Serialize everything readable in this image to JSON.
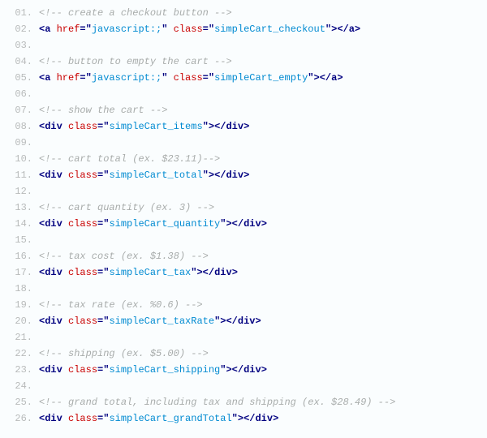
{
  "lines": [
    {
      "no": "01.",
      "type": "comment",
      "text": "<!-- create a checkout button -->"
    },
    {
      "no": "02.",
      "type": "code",
      "tokens": [
        {
          "t": "punct",
          "v": "<"
        },
        {
          "t": "tag",
          "v": "a"
        },
        {
          "t": "space",
          "v": " "
        },
        {
          "t": "attr-name",
          "v": "href"
        },
        {
          "t": "eq",
          "v": "="
        },
        {
          "t": "punct",
          "v": "\""
        },
        {
          "t": "attr-value",
          "v": "javascript:;"
        },
        {
          "t": "punct",
          "v": "\""
        },
        {
          "t": "space",
          "v": " "
        },
        {
          "t": "attr-name",
          "v": "class"
        },
        {
          "t": "eq",
          "v": "="
        },
        {
          "t": "punct",
          "v": "\""
        },
        {
          "t": "attr-value",
          "v": "simpleCart_checkout"
        },
        {
          "t": "punct",
          "v": "\""
        },
        {
          "t": "punct",
          "v": ">"
        },
        {
          "t": "punct",
          "v": "</"
        },
        {
          "t": "tag",
          "v": "a"
        },
        {
          "t": "punct",
          "v": ">"
        }
      ]
    },
    {
      "no": "03.",
      "type": "blank"
    },
    {
      "no": "04.",
      "type": "comment",
      "text": "<!-- button to empty the cart -->"
    },
    {
      "no": "05.",
      "type": "code",
      "tokens": [
        {
          "t": "punct",
          "v": "<"
        },
        {
          "t": "tag",
          "v": "a"
        },
        {
          "t": "space",
          "v": " "
        },
        {
          "t": "attr-name",
          "v": "href"
        },
        {
          "t": "eq",
          "v": "="
        },
        {
          "t": "punct",
          "v": "\""
        },
        {
          "t": "attr-value",
          "v": "javascript:;"
        },
        {
          "t": "punct",
          "v": "\""
        },
        {
          "t": "space",
          "v": " "
        },
        {
          "t": "attr-name",
          "v": "class"
        },
        {
          "t": "eq",
          "v": "="
        },
        {
          "t": "punct",
          "v": "\""
        },
        {
          "t": "attr-value",
          "v": "simpleCart_empty"
        },
        {
          "t": "punct",
          "v": "\""
        },
        {
          "t": "punct",
          "v": ">"
        },
        {
          "t": "punct",
          "v": "</"
        },
        {
          "t": "tag",
          "v": "a"
        },
        {
          "t": "punct",
          "v": ">"
        }
      ]
    },
    {
      "no": "06.",
      "type": "blank"
    },
    {
      "no": "07.",
      "type": "comment",
      "text": "<!-- show the cart -->"
    },
    {
      "no": "08.",
      "type": "code",
      "tokens": [
        {
          "t": "punct",
          "v": "<"
        },
        {
          "t": "tag",
          "v": "div"
        },
        {
          "t": "space",
          "v": " "
        },
        {
          "t": "attr-name",
          "v": "class"
        },
        {
          "t": "eq",
          "v": "="
        },
        {
          "t": "punct",
          "v": "\""
        },
        {
          "t": "attr-value",
          "v": "simpleCart_items"
        },
        {
          "t": "punct",
          "v": "\""
        },
        {
          "t": "punct",
          "v": ">"
        },
        {
          "t": "punct",
          "v": "</"
        },
        {
          "t": "tag",
          "v": "div"
        },
        {
          "t": "punct",
          "v": ">"
        }
      ]
    },
    {
      "no": "09.",
      "type": "blank"
    },
    {
      "no": "10.",
      "type": "comment",
      "text": "<!-- cart total (ex. $23.11)-->"
    },
    {
      "no": "11.",
      "type": "code",
      "tokens": [
        {
          "t": "punct",
          "v": "<"
        },
        {
          "t": "tag",
          "v": "div"
        },
        {
          "t": "space",
          "v": " "
        },
        {
          "t": "attr-name",
          "v": "class"
        },
        {
          "t": "eq",
          "v": "="
        },
        {
          "t": "punct",
          "v": "\""
        },
        {
          "t": "attr-value",
          "v": "simpleCart_total"
        },
        {
          "t": "punct",
          "v": "\""
        },
        {
          "t": "punct",
          "v": ">"
        },
        {
          "t": "punct",
          "v": "</"
        },
        {
          "t": "tag",
          "v": "div"
        },
        {
          "t": "punct",
          "v": ">"
        }
      ]
    },
    {
      "no": "12.",
      "type": "blank"
    },
    {
      "no": "13.",
      "type": "comment",
      "text": "<!-- cart quantity (ex. 3) -->"
    },
    {
      "no": "14.",
      "type": "code",
      "tokens": [
        {
          "t": "punct",
          "v": "<"
        },
        {
          "t": "tag",
          "v": "div"
        },
        {
          "t": "space",
          "v": " "
        },
        {
          "t": "attr-name",
          "v": "class"
        },
        {
          "t": "eq",
          "v": "="
        },
        {
          "t": "punct",
          "v": "\""
        },
        {
          "t": "attr-value",
          "v": "simpleCart_quantity"
        },
        {
          "t": "punct",
          "v": "\""
        },
        {
          "t": "punct",
          "v": ">"
        },
        {
          "t": "punct",
          "v": "</"
        },
        {
          "t": "tag",
          "v": "div"
        },
        {
          "t": "punct",
          "v": ">"
        }
      ]
    },
    {
      "no": "15.",
      "type": "blank"
    },
    {
      "no": "16.",
      "type": "comment",
      "text": "<!-- tax cost (ex. $1.38) -->"
    },
    {
      "no": "17.",
      "type": "code",
      "tokens": [
        {
          "t": "punct",
          "v": "<"
        },
        {
          "t": "tag",
          "v": "div"
        },
        {
          "t": "space",
          "v": " "
        },
        {
          "t": "attr-name",
          "v": "class"
        },
        {
          "t": "eq",
          "v": "="
        },
        {
          "t": "punct",
          "v": "\""
        },
        {
          "t": "attr-value",
          "v": "simpleCart_tax"
        },
        {
          "t": "punct",
          "v": "\""
        },
        {
          "t": "punct",
          "v": ">"
        },
        {
          "t": "punct",
          "v": "</"
        },
        {
          "t": "tag",
          "v": "div"
        },
        {
          "t": "punct",
          "v": ">"
        }
      ]
    },
    {
      "no": "18.",
      "type": "blank"
    },
    {
      "no": "19.",
      "type": "comment",
      "text": "<!-- tax rate (ex. %0.6) -->"
    },
    {
      "no": "20.",
      "type": "code",
      "tokens": [
        {
          "t": "punct",
          "v": "<"
        },
        {
          "t": "tag",
          "v": "div"
        },
        {
          "t": "space",
          "v": " "
        },
        {
          "t": "attr-name",
          "v": "class"
        },
        {
          "t": "eq",
          "v": "="
        },
        {
          "t": "punct",
          "v": "\""
        },
        {
          "t": "attr-value",
          "v": "simpleCart_taxRate"
        },
        {
          "t": "punct",
          "v": "\""
        },
        {
          "t": "punct",
          "v": ">"
        },
        {
          "t": "punct",
          "v": "</"
        },
        {
          "t": "tag",
          "v": "div"
        },
        {
          "t": "punct",
          "v": ">"
        }
      ]
    },
    {
      "no": "21.",
      "type": "blank"
    },
    {
      "no": "22.",
      "type": "comment",
      "text": "<!-- shipping (ex. $5.00) -->"
    },
    {
      "no": "23.",
      "type": "code",
      "tokens": [
        {
          "t": "punct",
          "v": "<"
        },
        {
          "t": "tag",
          "v": "div"
        },
        {
          "t": "space",
          "v": " "
        },
        {
          "t": "attr-name",
          "v": "class"
        },
        {
          "t": "eq",
          "v": "="
        },
        {
          "t": "punct",
          "v": "\""
        },
        {
          "t": "attr-value",
          "v": "simpleCart_shipping"
        },
        {
          "t": "punct",
          "v": "\""
        },
        {
          "t": "punct",
          "v": ">"
        },
        {
          "t": "punct",
          "v": "</"
        },
        {
          "t": "tag",
          "v": "div"
        },
        {
          "t": "punct",
          "v": ">"
        }
      ]
    },
    {
      "no": "24.",
      "type": "blank"
    },
    {
      "no": "25.",
      "type": "comment",
      "text": "<!-- grand total, including tax and shipping (ex. $28.49) -->"
    },
    {
      "no": "26.",
      "type": "code",
      "tokens": [
        {
          "t": "punct",
          "v": "<"
        },
        {
          "t": "tag",
          "v": "div"
        },
        {
          "t": "space",
          "v": " "
        },
        {
          "t": "attr-name",
          "v": "class"
        },
        {
          "t": "eq",
          "v": "="
        },
        {
          "t": "punct",
          "v": "\""
        },
        {
          "t": "attr-value",
          "v": "simpleCart_grandTotal"
        },
        {
          "t": "punct",
          "v": "\""
        },
        {
          "t": "punct",
          "v": ">"
        },
        {
          "t": "punct",
          "v": "</"
        },
        {
          "t": "tag",
          "v": "div"
        },
        {
          "t": "punct",
          "v": ">"
        }
      ]
    }
  ]
}
